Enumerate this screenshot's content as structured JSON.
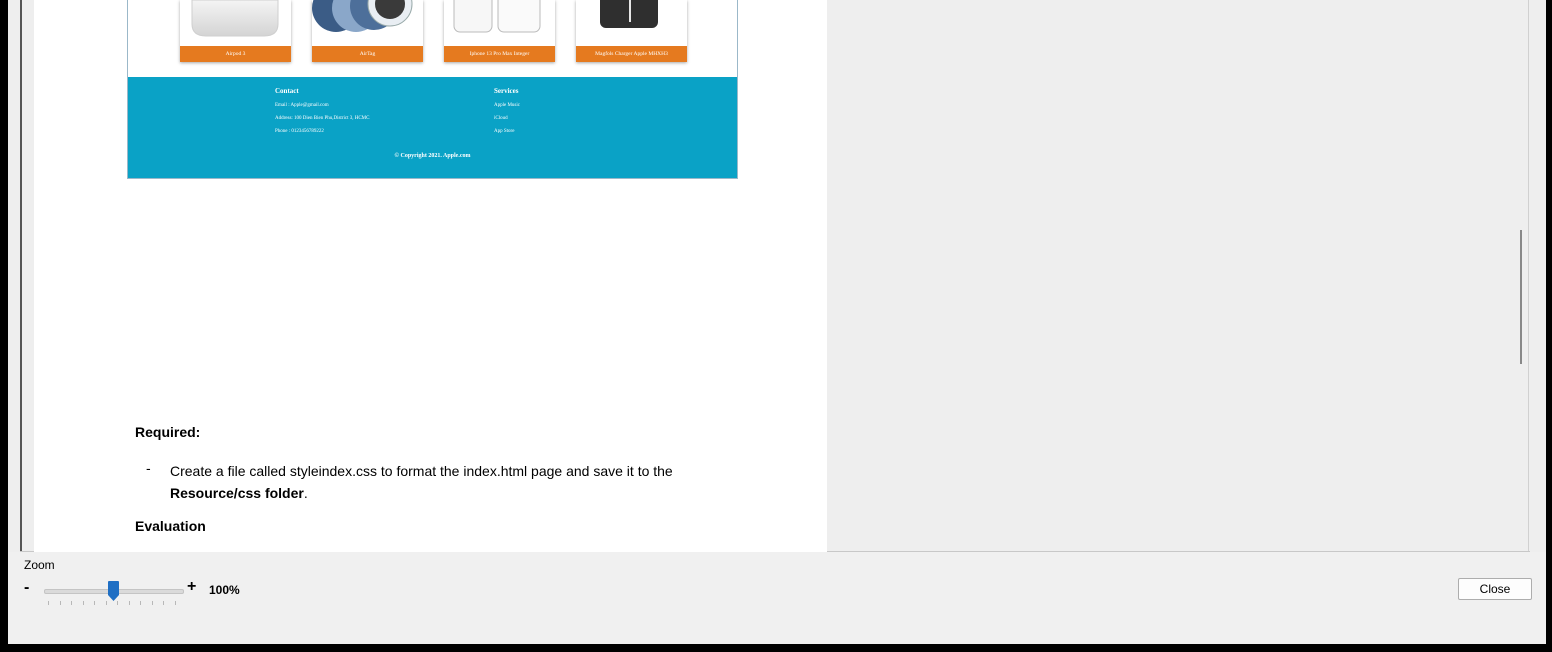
{
  "products": [
    {
      "name": "Airpod 3",
      "image_icon": "airpods-case-icon"
    },
    {
      "name": "AirTag",
      "image_icon": "airtag-icon"
    },
    {
      "name": "Iphone 13 Pro Max Integer",
      "image_icon": "phone-case-icon"
    },
    {
      "name": "Magfols Charger Apple MHXH3",
      "image_icon": "charger-icon"
    }
  ],
  "footer": {
    "contact_heading": "Contact",
    "email": "Email : Apple@gmail.com",
    "address": "Address: 100 Dien Bien Phu,District 3, HCMC",
    "phone": "Phone : 0123456789222",
    "services_heading": "Services",
    "services": [
      "Apple Music",
      "iCloud",
      "App Store"
    ],
    "copyright": "© Copyright 2021. Apple.com"
  },
  "document": {
    "required_heading": "Required:",
    "bullet_dash": "-",
    "bullet_text_1": "Create a file called styleindex.css to format the index.html page and save it to the ",
    "bullet_bold_1": "Resource/css folder",
    "bullet_end": ".",
    "evaluation_heading": "Evaluation"
  },
  "zoom": {
    "label": "Zoom",
    "minus": "-",
    "plus": "+",
    "value_text": "100%",
    "level_fraction": 0.5
  },
  "close_label": "Close",
  "colors": {
    "card_label_bg": "#e57a1f",
    "footer_bg": "#0aa2c6",
    "slider_thumb": "#1f6fc4"
  }
}
